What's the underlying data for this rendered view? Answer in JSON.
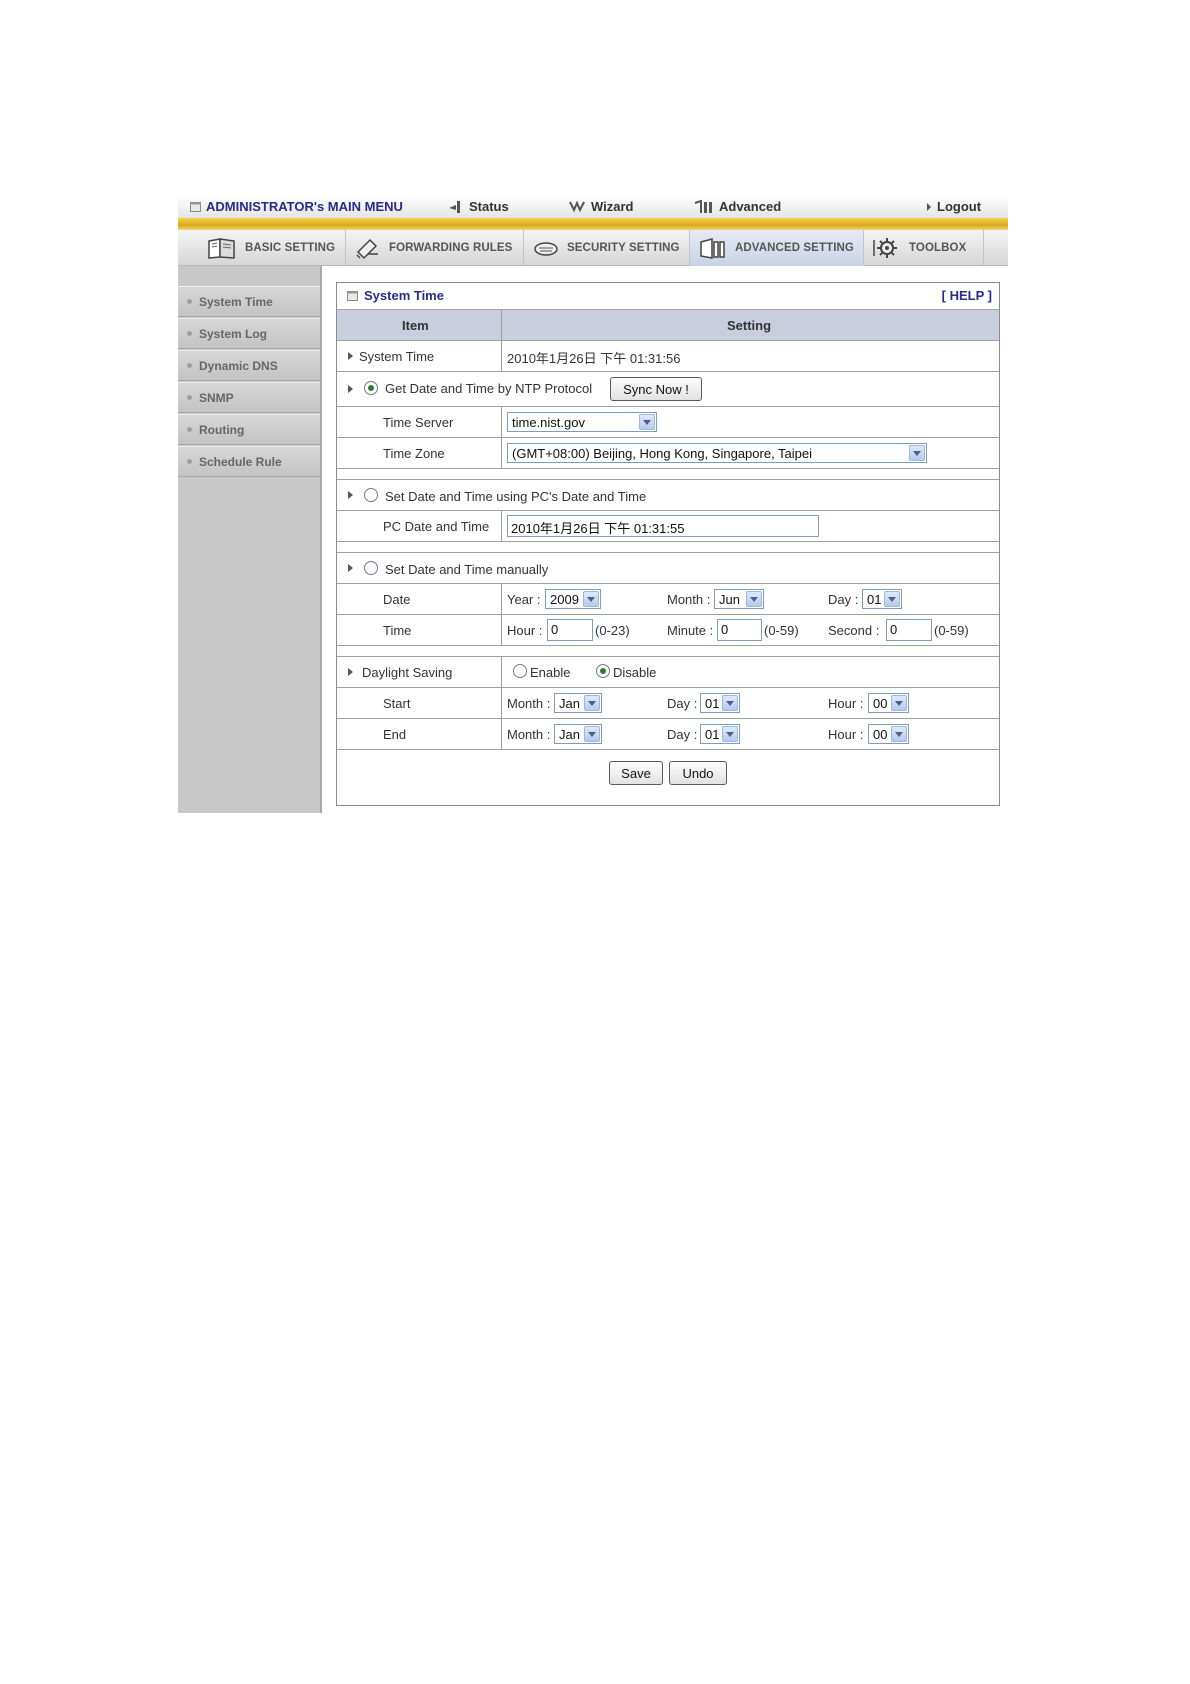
{
  "topmenu": {
    "main_menu": "ADMINISTRATOR's MAIN MENU",
    "status": "Status",
    "wizard": "Wizard",
    "advanced": "Advanced",
    "logout": "Logout"
  },
  "tabs": [
    {
      "label": "BASIC SETTING",
      "icon": "book-icon"
    },
    {
      "label": "FORWARDING RULES",
      "icon": "pen-icon"
    },
    {
      "label": "SECURITY SETTING",
      "icon": "router-icon"
    },
    {
      "label": "ADVANCED SETTING",
      "icon": "cabinet-icon"
    },
    {
      "label": "TOOLBOX",
      "icon": "gear-icon"
    }
  ],
  "sidebar": {
    "items": [
      "System Time",
      "System Log",
      "Dynamic DNS",
      "SNMP",
      "Routing",
      "Schedule Rule"
    ]
  },
  "panel": {
    "title": "System Time",
    "help": "[ HELP ]",
    "col_item": "Item",
    "col_setting": "Setting",
    "system_time": {
      "label": "System Time",
      "value": "2010年1月26日 下午 01:31:56"
    },
    "ntp": {
      "label": "Get Date and Time by NTP Protocol",
      "selected": true,
      "sync_button": "Sync Now !",
      "time_server_label": "Time Server",
      "time_server_value": "time.nist.gov",
      "time_zone_label": "Time Zone",
      "time_zone_value": "(GMT+08:00) Beijing, Hong Kong, Singapore, Taipei"
    },
    "pc": {
      "label": "Set Date and Time using PC's Date and Time",
      "selected": false,
      "pc_label": "PC Date and Time",
      "pc_value": "2010年1月26日 下午 01:31:55"
    },
    "manual": {
      "label": "Set Date and Time manually",
      "selected": false,
      "date_label": "Date",
      "year_label": "Year :",
      "year_value": "2009",
      "month_label": "Month :",
      "month_value": "Jun",
      "day_label": "Day :",
      "day_value": "01",
      "time_label": "Time",
      "hour_label": "Hour :",
      "hour_value": "0",
      "hour_range": "(0-23)",
      "minute_label": "Minute :",
      "minute_value": "0",
      "minute_range": "(0-59)",
      "second_label": "Second :",
      "second_value": "0",
      "second_range": "(0-59)"
    },
    "daylight": {
      "label": "Daylight Saving",
      "enable_label": "Enable",
      "disable_label": "Disable",
      "enabled": false,
      "start_label": "Start",
      "end_label": "End",
      "month_label": "Month :",
      "day_label": "Day :",
      "hour_label": "Hour :",
      "start_month": "Jan",
      "start_day": "01",
      "start_hour": "00",
      "end_month": "Jan",
      "end_day": "01",
      "end_hour": "00"
    },
    "save_button": "Save",
    "undo_button": "Undo"
  }
}
